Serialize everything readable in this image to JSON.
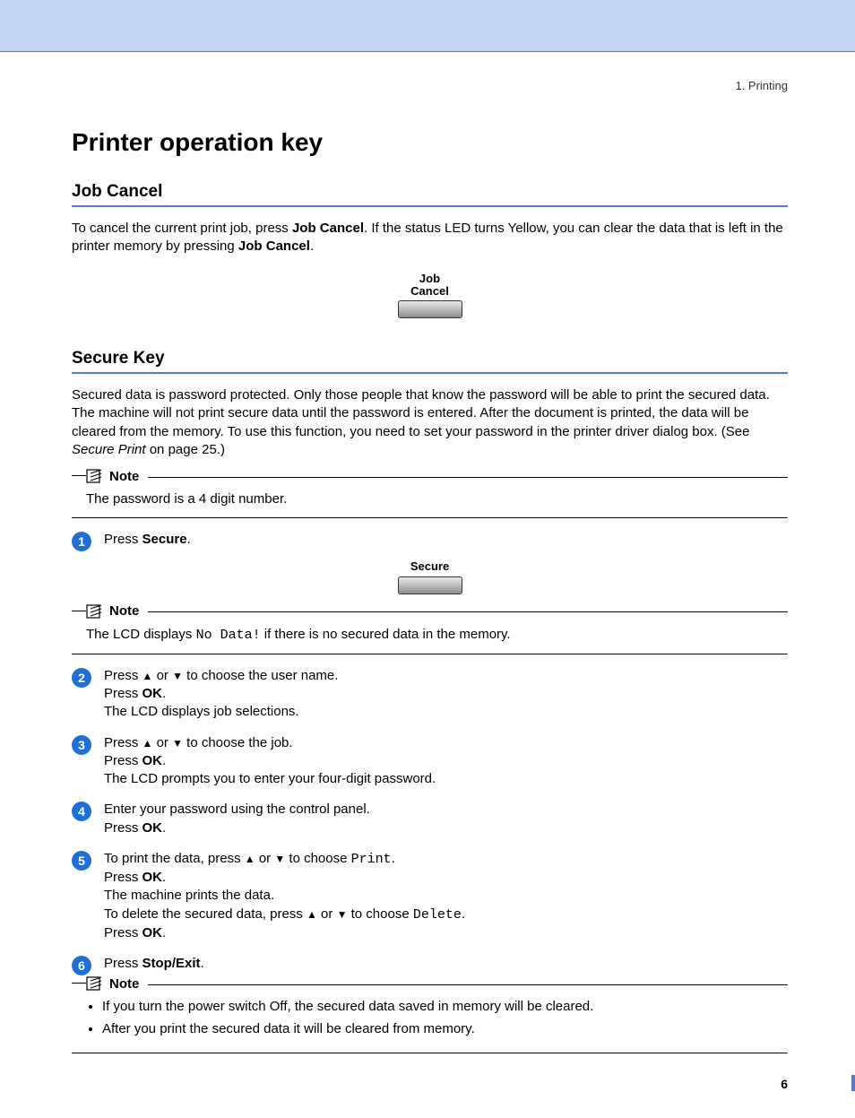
{
  "breadcrumb": "1. Printing",
  "page_title": "Printer operation key",
  "page_number": "6",
  "job_cancel": {
    "heading": "Job Cancel",
    "intro_pre": "To cancel the current print job, press ",
    "intro_bold1": "Job Cancel",
    "intro_mid": ". If the status LED turns Yellow, you can clear the data that is left in the printer memory by pressing ",
    "intro_bold2": "Job Cancel",
    "intro_post": ".",
    "button_label": "Job\nCancel"
  },
  "secure": {
    "heading": "Secure Key",
    "intro": "Secured data is password protected. Only those people that know the password will be able to print the secured data. The machine will not print secure data until the password is entered. After the document is printed, the data will be cleared from the memory. To use this function, you need to set your password in the printer driver dialog box. (See ",
    "intro_link": "Secure Print",
    "intro_post": " on page 25.)",
    "note1_title": "Note",
    "note1_body": "The password is a 4 digit number.",
    "button_label": "Secure",
    "note2_title": "Note",
    "note2_pre": "The LCD displays ",
    "note2_mono": "No Data!",
    "note2_post": " if there is no secured data in the memory.",
    "steps": {
      "s1": {
        "pre": "Press ",
        "bold": "Secure",
        "post": "."
      },
      "s2": {
        "l1_a": "Press ",
        "l1_b": " or ",
        "l1_c": " to choose the user name.",
        "l2_a": "Press ",
        "l2_b": "OK",
        "l2_c": ".",
        "l3": "The LCD displays job selections."
      },
      "s3": {
        "l1_a": "Press ",
        "l1_b": " or ",
        "l1_c": " to choose the job.",
        "l2_a": "Press ",
        "l2_b": "OK",
        "l2_c": ".",
        "l3": "The LCD prompts you to enter your four-digit password."
      },
      "s4": {
        "l1": "Enter your password using the control panel.",
        "l2_a": "Press ",
        "l2_b": "OK",
        "l2_c": "."
      },
      "s5": {
        "l1_a": "To print the data, press ",
        "l1_b": " or ",
        "l1_c": " to choose ",
        "l1_mono": "Print",
        "l1_d": ".",
        "l2_a": "Press ",
        "l2_b": "OK",
        "l2_c": ".",
        "l3": "The machine prints the data.",
        "l4_a": "To delete the secured data, press ",
        "l4_b": " or ",
        "l4_c": " to choose ",
        "l4_mono": "Delete",
        "l4_d": ".",
        "l5_a": "Press ",
        "l5_b": "OK",
        "l5_c": "."
      },
      "s6": {
        "pre": "Press ",
        "bold": "Stop/Exit",
        "post": "."
      }
    },
    "note3_title": "Note",
    "note3_items": [
      "If you turn the power switch Off, the secured data saved in memory will be cleared.",
      "After you print the secured data it will be cleared from memory."
    ]
  }
}
